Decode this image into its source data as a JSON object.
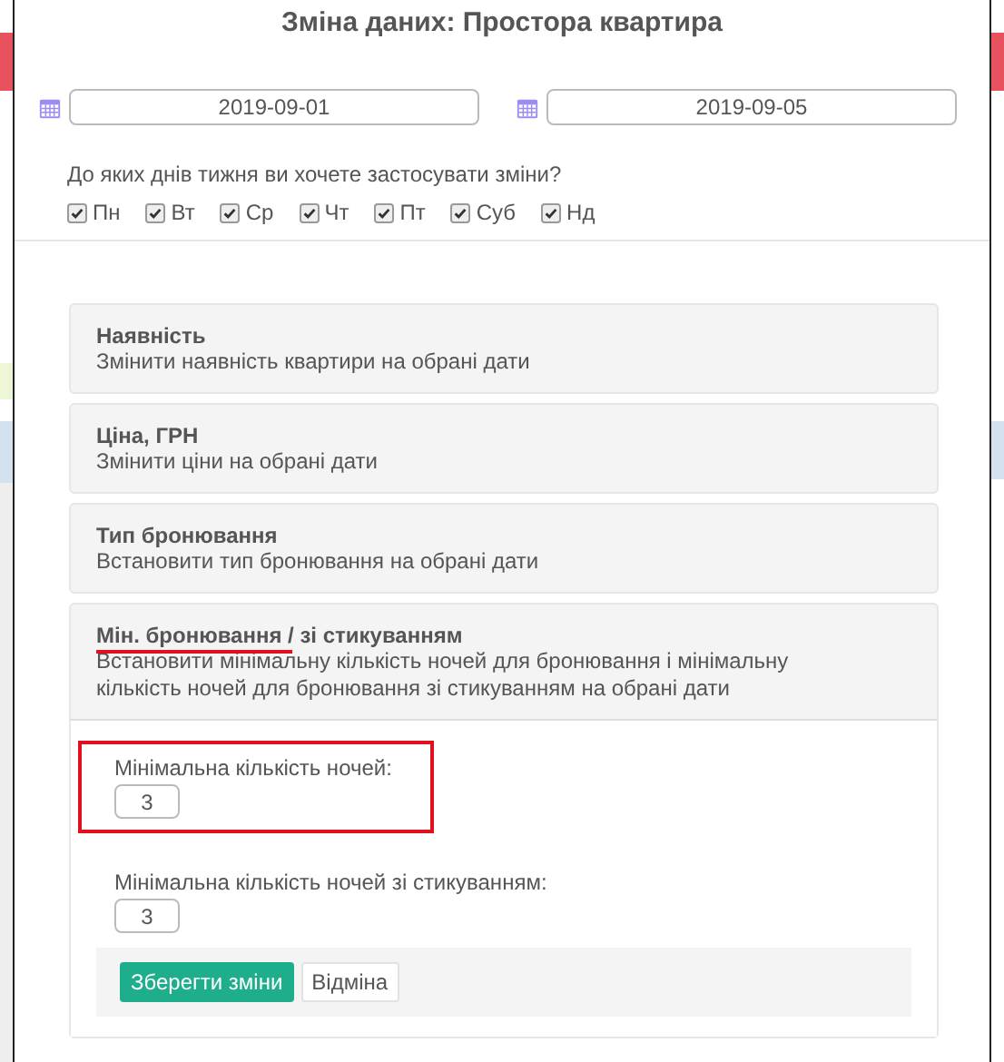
{
  "modal": {
    "title": "Зміна даних: Простора квартира"
  },
  "date_from": {
    "value": "2019-09-01"
  },
  "date_to": {
    "value": "2019-09-05"
  },
  "days_question": "До яких днів тижня ви хочете застосувати зміни?",
  "days": [
    {
      "label": "Пн",
      "checked": true
    },
    {
      "label": "Вт",
      "checked": true
    },
    {
      "label": "Ср",
      "checked": true
    },
    {
      "label": "Чт",
      "checked": true
    },
    {
      "label": "Пт",
      "checked": true
    },
    {
      "label": "Суб",
      "checked": true
    },
    {
      "label": "Нд",
      "checked": true
    }
  ],
  "options": [
    {
      "title": "Наявність",
      "description": "Змінити наявність квартири на обрані дати",
      "expanded": false
    },
    {
      "title": "Ціна, ГРН",
      "description": "Змінити ціни на обрані дати",
      "expanded": false
    },
    {
      "title": "Тип бронювання",
      "description": "Встановити тип бронювання на обрані дати",
      "expanded": false
    },
    {
      "title": "Мін. бронювання / зі стикуванням",
      "description": "Встановити мінімальну кількість ночей для бронювання і мінімальну кількість ночей для бронювання зі стикуванням на обрані дати",
      "expanded": true,
      "underlined": true
    }
  ],
  "form": {
    "fields": [
      {
        "label": "Мінімальна кількість ночей:",
        "value": "3",
        "highlighted": true
      },
      {
        "label": "Мінімальна кількість ночей зі стикуванням:",
        "value": "3",
        "highlighted": false
      }
    ],
    "save_button": "Зберегти зміни",
    "cancel_button": "Відміна"
  }
}
